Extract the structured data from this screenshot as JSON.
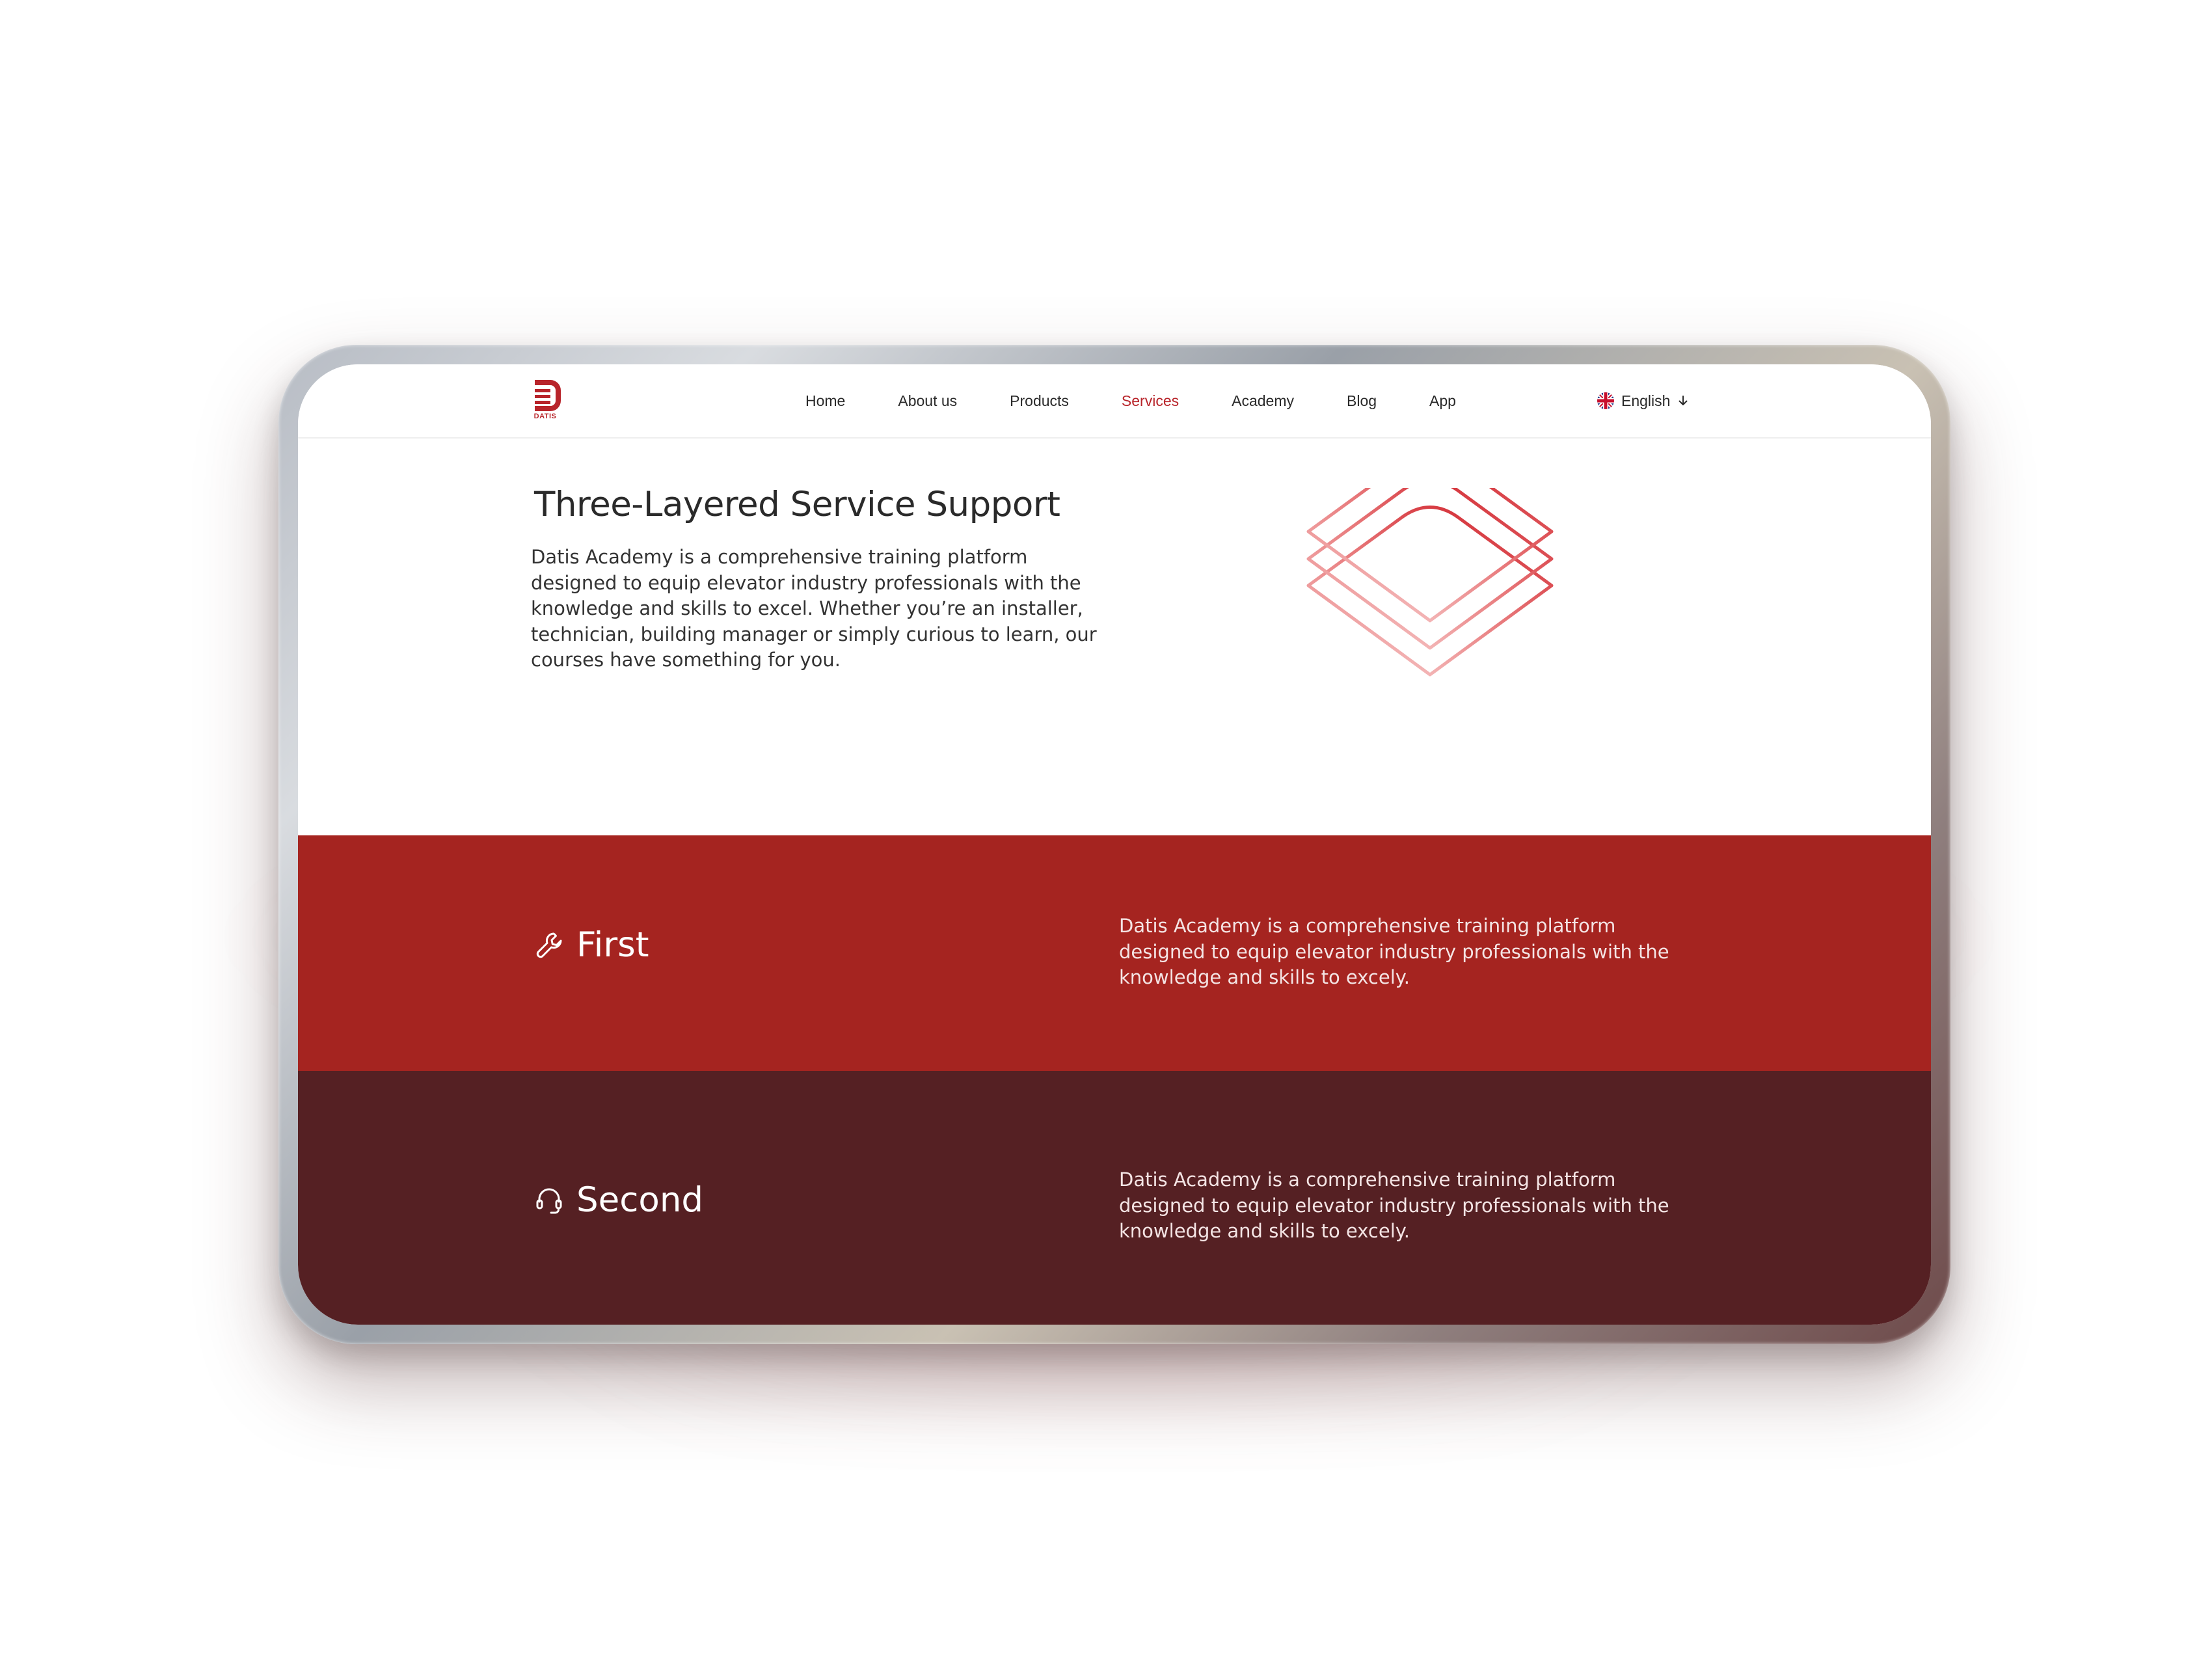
{
  "nav": {
    "logo_text": "DATIS",
    "items": [
      {
        "label": "Home",
        "active": false
      },
      {
        "label": "About us",
        "active": false
      },
      {
        "label": "Products",
        "active": false
      },
      {
        "label": "Services",
        "active": true
      },
      {
        "label": "Academy",
        "active": false
      },
      {
        "label": "Blog",
        "active": false
      },
      {
        "label": "App",
        "active": false
      }
    ],
    "language": "English"
  },
  "hero": {
    "title": "Three-Layered Service Support",
    "text": "Datis Academy is a comprehensive training platform designed to equip elevator industry professionals with the knowledge and skills to excel. Whether you’re an installer, technician, building manager or simply curious to learn, our courses have something for you."
  },
  "services": [
    {
      "title": "First",
      "icon": "wrench-icon",
      "text": "Datis Academy is a comprehensive training platform designed to equip elevator industry professionals with the knowledge and skills to excely."
    },
    {
      "title": "Second",
      "icon": "headset-icon",
      "text": "Datis Academy is a comprehensive training platform designed to equip elevator industry professionals with the knowledge and skills to excely."
    }
  ],
  "colors": {
    "brand_red": "#b8242a",
    "band_first": "#a52420",
    "band_second": "#552023"
  }
}
